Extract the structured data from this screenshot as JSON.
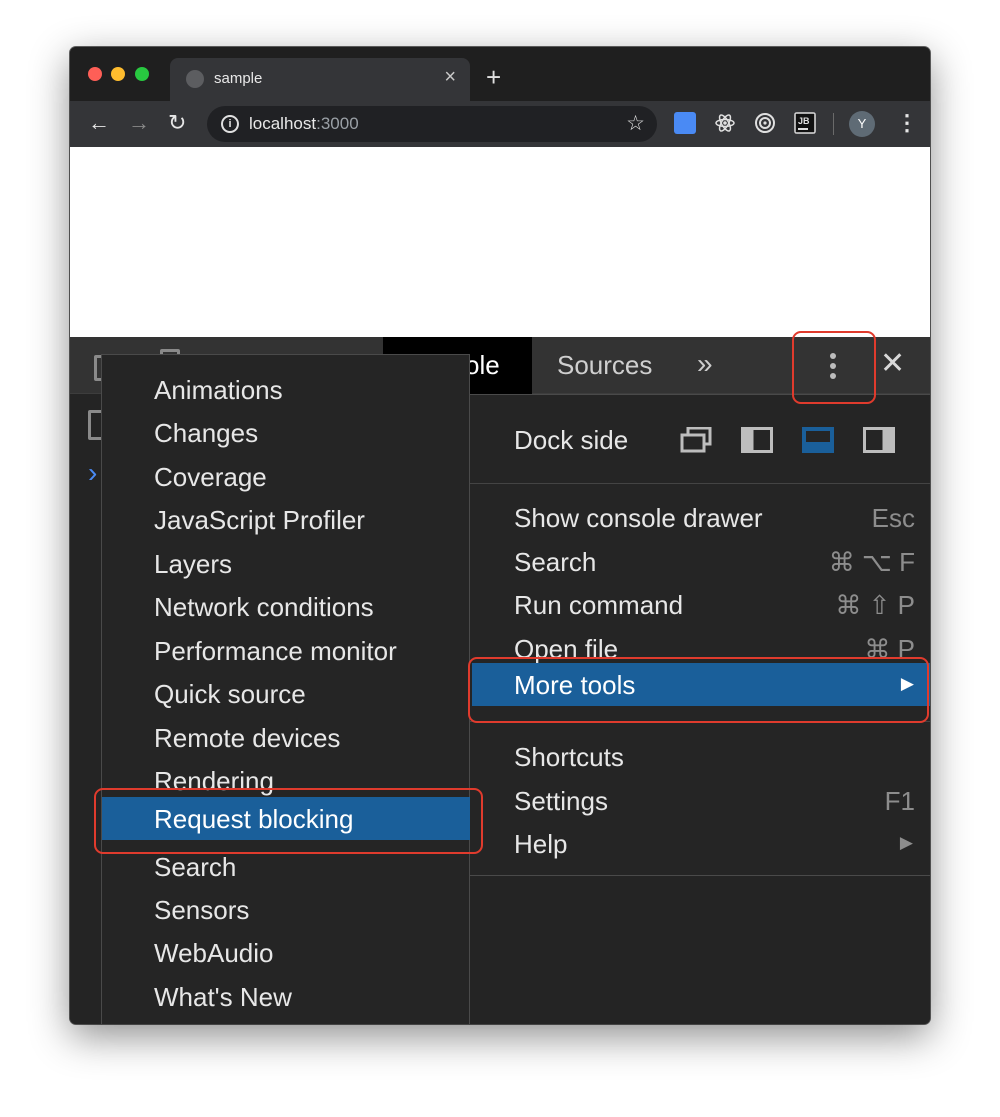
{
  "browser": {
    "tab_title": "sample",
    "tab_close": "×",
    "new_tab": "+",
    "url_host": "localhost",
    "url_port": ":3000",
    "profile_initial": "Y",
    "nav": {
      "back": "←",
      "forward": "→",
      "reload": "↻"
    },
    "star": "☆"
  },
  "devtools": {
    "tabs": [
      {
        "label": "ole",
        "active": true
      },
      {
        "label": "Sources",
        "active": false
      }
    ],
    "overflow": "»",
    "close": "✕",
    "console_prompt": "›",
    "main_menu": {
      "dock_side_label": "Dock side",
      "items": [
        {
          "label": "Show console drawer",
          "shortcut": "Esc"
        },
        {
          "label": "Search",
          "shortcut": "⌘ ⌥ F"
        },
        {
          "label": "Run command",
          "shortcut": "⌘ ⇧ P"
        },
        {
          "label": "Open file",
          "shortcut": "⌘ P"
        },
        {
          "label": "More tools",
          "shortcut": "▶",
          "highlighted": true
        },
        {
          "label": "Shortcuts",
          "shortcut": ""
        },
        {
          "label": "Settings",
          "shortcut": "F1"
        },
        {
          "label": "Help",
          "shortcut": "▶"
        }
      ]
    },
    "more_tools_menu": {
      "items": [
        {
          "label": "Animations"
        },
        {
          "label": "Changes"
        },
        {
          "label": "Coverage"
        },
        {
          "label": "JavaScript Profiler"
        },
        {
          "label": "Layers"
        },
        {
          "label": "Network conditions"
        },
        {
          "label": "Performance monitor"
        },
        {
          "label": "Quick source"
        },
        {
          "label": "Remote devices"
        },
        {
          "label": "Rendering"
        },
        {
          "label": "Request blocking",
          "highlighted": true
        },
        {
          "label": "Search"
        },
        {
          "label": "Sensors"
        },
        {
          "label": "WebAudio"
        },
        {
          "label": "What's New"
        }
      ]
    }
  },
  "colors": {
    "highlight": "#1a5f9a",
    "annotation_red": "#e03b2d",
    "menu_bg": "#252525"
  }
}
